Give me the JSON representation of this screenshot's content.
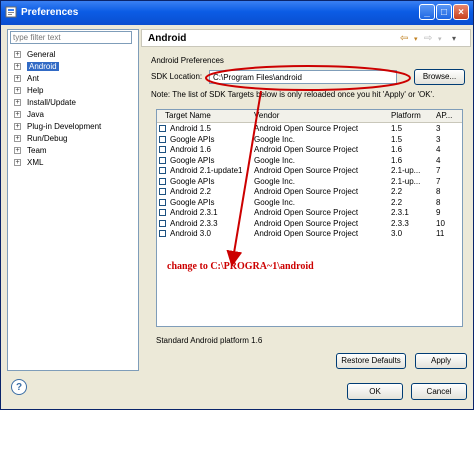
{
  "window": {
    "title": "Preferences",
    "buttons": [
      "_",
      "□",
      "×"
    ]
  },
  "left_panel": {
    "filter_placeholder": "type filter text",
    "items": [
      {
        "label": "General",
        "selected": false
      },
      {
        "label": "Android",
        "selected": true
      },
      {
        "label": "Ant",
        "selected": false
      },
      {
        "label": "Help",
        "selected": false
      },
      {
        "label": "Install/Update",
        "selected": false
      },
      {
        "label": "Java",
        "selected": false
      },
      {
        "label": "Plug-in Development",
        "selected": false
      },
      {
        "label": "Run/Debug",
        "selected": false
      },
      {
        "label": "Team",
        "selected": false
      },
      {
        "label": "XML",
        "selected": false
      }
    ]
  },
  "page": {
    "title": "Android",
    "subtitle": "Android Preferences",
    "sdk_label": "SDK Location:",
    "sdk_value": "C:\\Program Files\\android",
    "browse_label": "Browse...",
    "note": "Note: The list of SDK Targets below is only reloaded once you hit 'Apply' or 'OK'.",
    "columns": [
      "Target Name",
      "Vendor",
      "Platform",
      "AP..."
    ],
    "targets": [
      [
        "Android 1.5",
        "Android Open Source Project",
        "1.5",
        "3"
      ],
      [
        "Google APIs",
        "Google Inc.",
        "1.5",
        "3"
      ],
      [
        "Android 1.6",
        "Android Open Source Project",
        "1.6",
        "4"
      ],
      [
        "Google APIs",
        "Google Inc.",
        "1.6",
        "4"
      ],
      [
        "Android 2.1-update1",
        "Android Open Source Project",
        "2.1-up...",
        "7"
      ],
      [
        "Google APIs",
        "Google Inc.",
        "2.1-up...",
        "7"
      ],
      [
        "Android 2.2",
        "Android Open Source Project",
        "2.2",
        "8"
      ],
      [
        "Google APIs",
        "Google Inc.",
        "2.2",
        "8"
      ],
      [
        "Android 2.3.1",
        "Android Open Source Project",
        "2.3.1",
        "9"
      ],
      [
        "Android 2.3.3",
        "Android Open Source Project",
        "2.3.3",
        "10"
      ],
      [
        "Android 3.0",
        "Android Open Source Project",
        "3.0",
        "11"
      ]
    ],
    "annotation": "change to C:\\PROGRA~1\\android",
    "status": "Standard Android platform 1.6",
    "restore_label": "Restore Defaults",
    "apply_label": "Apply"
  },
  "footer": {
    "help_label": "?",
    "ok_label": "OK",
    "cancel_label": "Cancel"
  },
  "colors": {
    "annotation": "#cc0000",
    "accent": "#316ac5"
  }
}
